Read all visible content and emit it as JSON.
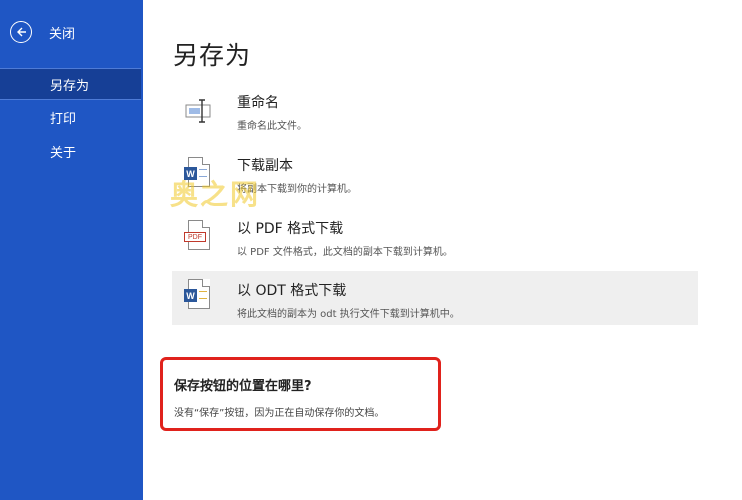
{
  "sidebar": {
    "back_label": "关闭",
    "items": [
      {
        "label": "另存为",
        "active": true
      },
      {
        "label": "打印",
        "active": false
      },
      {
        "label": "关于",
        "active": false
      }
    ],
    "bg_color": "#1f56c4"
  },
  "main": {
    "title": "另存为",
    "options": [
      {
        "title": "重命名",
        "desc": "重命名此文件。",
        "icon": "rename-icon"
      },
      {
        "title": "下载副本",
        "desc": "将副本下载到你的计算机。",
        "icon": "word-doc-icon"
      },
      {
        "title": "以 PDF 格式下载",
        "desc": "以 PDF 文件格式，此文档的副本下载到计算机。",
        "icon": "pdf-doc-icon",
        "badge": "PDF"
      },
      {
        "title": "以 ODT 格式下载",
        "desc": "将此文档的副本为 odt 执行文件下载到计算机中。",
        "icon": "odt-doc-icon"
      }
    ],
    "callout": {
      "question": "保存按钮的位置在哪里?",
      "answer": "没有“保存”按钮，因为正在自动保存你的文档。",
      "border_color": "#e0221c"
    }
  },
  "watermark": "奥之网"
}
